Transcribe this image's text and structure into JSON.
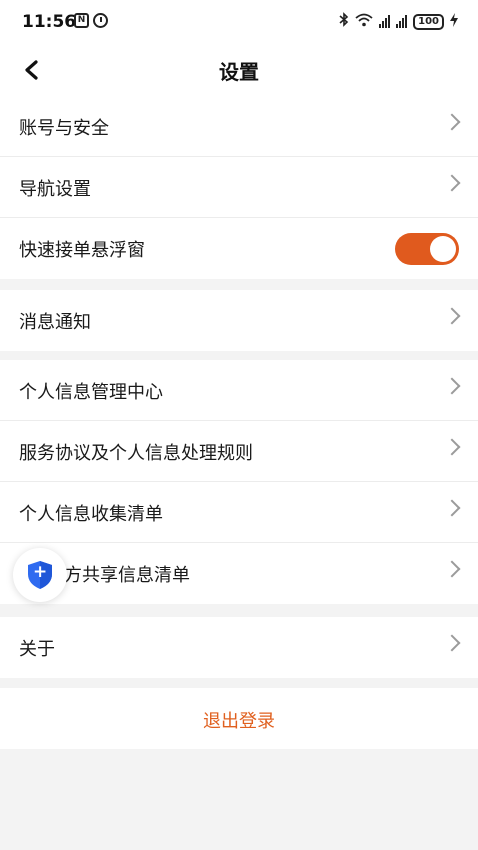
{
  "status_bar": {
    "time": "11:56",
    "nfc_icon_text": "N",
    "battery": "100",
    "icons": [
      "nfc-icon",
      "alarm-icon",
      "bluetooth-icon",
      "wifi-icon",
      "signal-icon",
      "signal-icon",
      "battery-icon",
      "charging-icon"
    ]
  },
  "nav": {
    "title": "设置",
    "back_icon": "chevron-left-icon"
  },
  "group1": {
    "account_security": "账号与安全",
    "navigation_settings": "导航设置",
    "quick_float_window": "快速接单悬浮窗",
    "quick_float_window_enabled": true
  },
  "group2": {
    "notifications": "消息通知"
  },
  "group3": {
    "personal_info_center": "个人信息管理中心",
    "service_agreement": "服务协议及个人信息处理规则",
    "info_collection_list": "个人信息收集清单",
    "third_party_sharing_list": "方共享信息清单"
  },
  "group4": {
    "about": "关于"
  },
  "logout": {
    "label": "退出登录"
  },
  "floating_button": {
    "icon": "shield-plus-icon",
    "glyph": "+"
  },
  "colors": {
    "accent": "#e05a1e",
    "background": "#f3f3f3"
  }
}
